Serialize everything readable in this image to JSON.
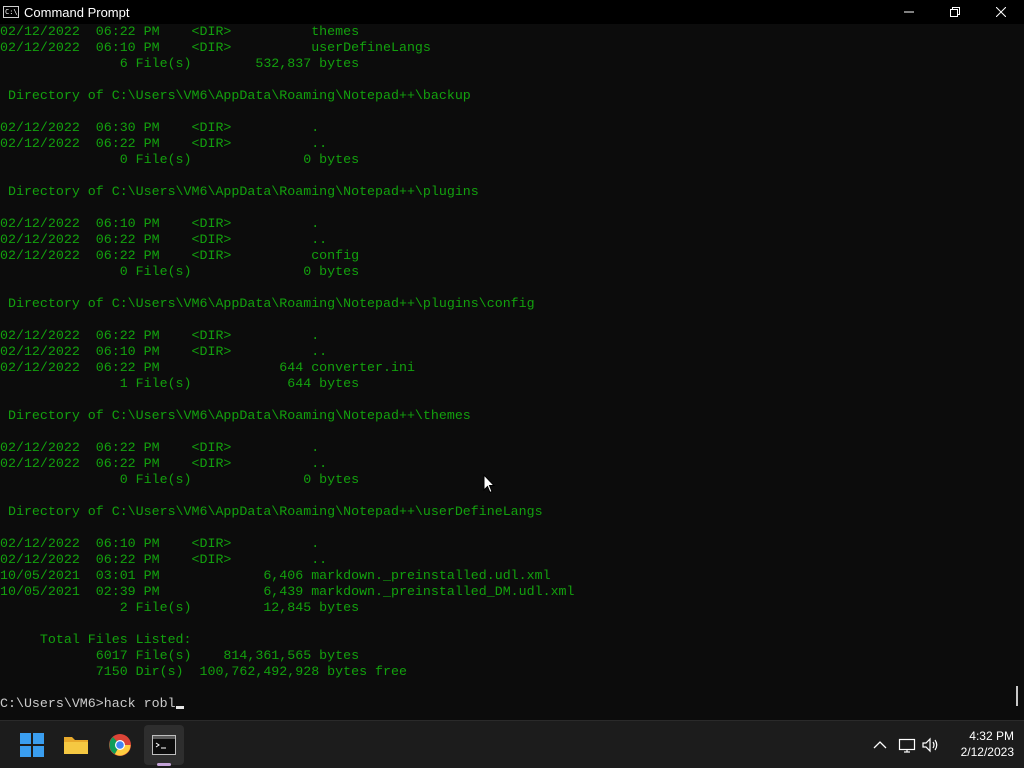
{
  "window": {
    "title": "Command Prompt",
    "icon_text": "C:\\_",
    "minimize_label": "—",
    "maximize_label": "□",
    "close_label": "✕"
  },
  "colors": {
    "console_bg": "#0c0c0c",
    "console_text": "#13a10e",
    "prompt_text": "#cccccc",
    "taskbar_bg": "#1c1c1c"
  },
  "console": {
    "lines": [
      "02/12/2022  06:22 PM    <DIR>          themes",
      "02/12/2022  06:10 PM    <DIR>          userDefineLangs",
      "               6 File(s)        532,837 bytes",
      "",
      " Directory of C:\\Users\\VM6\\AppData\\Roaming\\Notepad++\\backup",
      "",
      "02/12/2022  06:30 PM    <DIR>          .",
      "02/12/2022  06:22 PM    <DIR>          ..",
      "               0 File(s)              0 bytes",
      "",
      " Directory of C:\\Users\\VM6\\AppData\\Roaming\\Notepad++\\plugins",
      "",
      "02/12/2022  06:10 PM    <DIR>          .",
      "02/12/2022  06:22 PM    <DIR>          ..",
      "02/12/2022  06:22 PM    <DIR>          config",
      "               0 File(s)              0 bytes",
      "",
      " Directory of C:\\Users\\VM6\\AppData\\Roaming\\Notepad++\\plugins\\config",
      "",
      "02/12/2022  06:22 PM    <DIR>          .",
      "02/12/2022  06:10 PM    <DIR>          ..",
      "02/12/2022  06:22 PM               644 converter.ini",
      "               1 File(s)            644 bytes",
      "",
      " Directory of C:\\Users\\VM6\\AppData\\Roaming\\Notepad++\\themes",
      "",
      "02/12/2022  06:22 PM    <DIR>          .",
      "02/12/2022  06:22 PM    <DIR>          ..",
      "               0 File(s)              0 bytes",
      "",
      " Directory of C:\\Users\\VM6\\AppData\\Roaming\\Notepad++\\userDefineLangs",
      "",
      "02/12/2022  06:10 PM    <DIR>          .",
      "02/12/2022  06:22 PM    <DIR>          ..",
      "10/05/2021  03:01 PM             6,406 markdown._preinstalled.udl.xml",
      "10/05/2021  02:39 PM             6,439 markdown._preinstalled_DM.udl.xml",
      "               2 File(s)         12,845 bytes",
      "",
      "     Total Files Listed:",
      "            6017 File(s)    814,361,565 bytes",
      "            7150 Dir(s)  100,762,492,928 bytes free",
      ""
    ],
    "prompt": "C:\\Users\\VM6>hack robl"
  },
  "taskbar": {
    "items": [
      {
        "name": "start",
        "icon": "windows-start-icon"
      },
      {
        "name": "file-explorer",
        "icon": "folder-icon"
      },
      {
        "name": "chrome",
        "icon": "chrome-icon"
      },
      {
        "name": "command-prompt",
        "icon": "terminal-icon",
        "active": true
      }
    ],
    "tray": [
      "chevron-up-icon",
      "network-icon",
      "volume-icon"
    ],
    "time": "4:32 PM",
    "date": "2/12/2023"
  }
}
